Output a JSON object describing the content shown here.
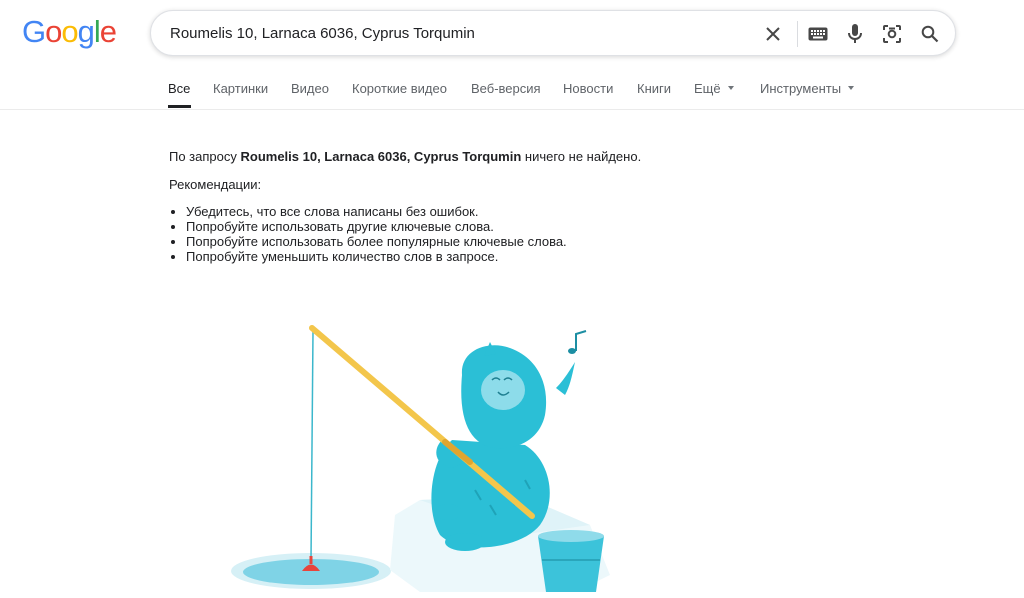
{
  "logo": {
    "text": "Google"
  },
  "search": {
    "query": "Roumelis 10, Larnaca 6036, Cyprus Torqumin"
  },
  "tabs": [
    {
      "label": "Все",
      "active": true
    },
    {
      "label": "Картинки"
    },
    {
      "label": "Видео"
    },
    {
      "label": "Короткие видео"
    },
    {
      "label": "Веб-версия"
    },
    {
      "label": "Новости"
    },
    {
      "label": "Книги"
    },
    {
      "label": "Ещё",
      "dropdown": true
    },
    {
      "label": "Инструменты",
      "dropdown": true
    }
  ],
  "results": {
    "prefix": "По запросу ",
    "query": "Roumelis 10, Larnaca 6036, Cyprus Torqumin",
    "suffix": " ничего не найдено.",
    "recommendations_title": "Рекомендации:",
    "tips": [
      "Убедитесь, что все слова написаны без ошибок.",
      "Попробуйте использовать другие ключевые слова.",
      "Попробуйте использовать более популярные ключевые слова.",
      "Попробуйте уменьшить количество слов в запросе."
    ]
  },
  "colors": {
    "google_blue": "#4285F4",
    "google_red": "#EA4335",
    "google_yellow": "#FBBC05",
    "google_green": "#34A853",
    "yeti": "#2bbfd6",
    "rod": "#f3c64b"
  }
}
